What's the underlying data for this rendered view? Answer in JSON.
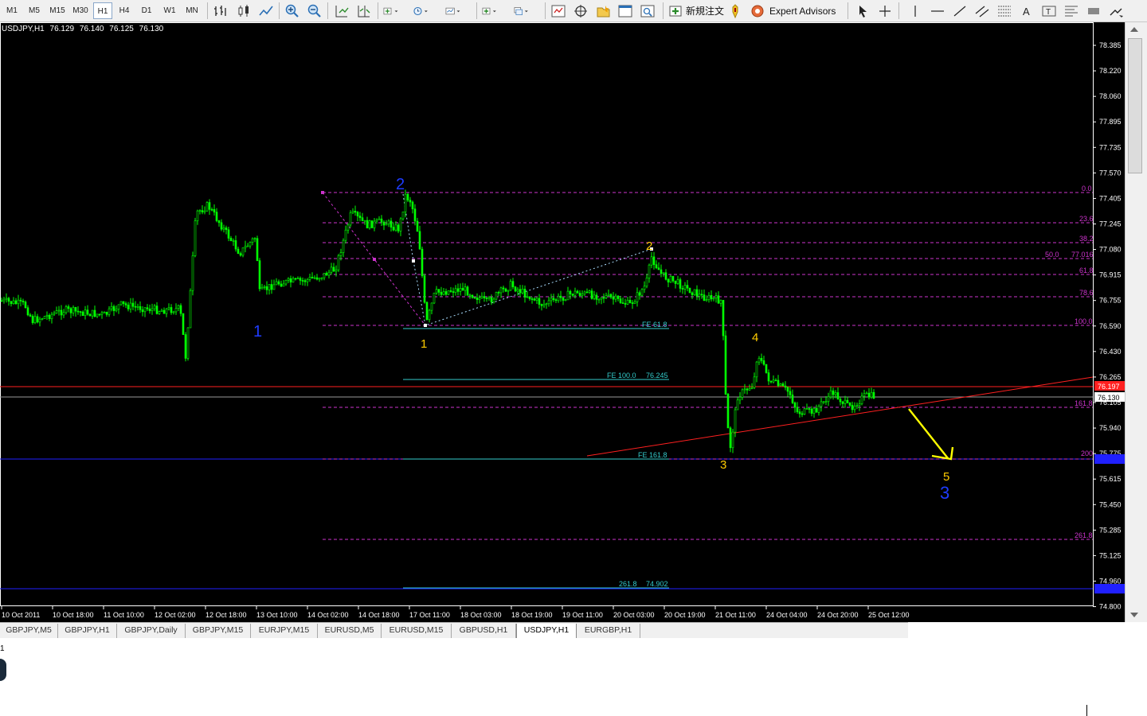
{
  "toolbar": {
    "timeframes": [
      {
        "label": "M1",
        "active": false
      },
      {
        "label": "M5",
        "active": false
      },
      {
        "label": "M15",
        "active": false
      },
      {
        "label": "M30",
        "active": false
      },
      {
        "label": "H1",
        "active": true
      },
      {
        "label": "H4",
        "active": false
      },
      {
        "label": "D1",
        "active": false
      },
      {
        "label": "W1",
        "active": false
      },
      {
        "label": "MN",
        "active": false
      }
    ],
    "new_order_label": "新規注文",
    "expert_advisors_label": "Expert Advisors",
    "icons": [
      "bar-chart-icon",
      "candlestick-icon",
      "line-chart-icon",
      "zoom-in-icon",
      "zoom-out-icon",
      "autoscroll-icon",
      "chart-shift-icon",
      "indicators-icon",
      "periods-icon",
      "templates-icon",
      "new-chart-icon",
      "profiles-icon",
      "market-watch-icon",
      "data-window-icon",
      "navigator-icon",
      "terminal-icon",
      "tester-icon",
      "new-order-icon",
      "expert-advisors-icon",
      "cursor-icon",
      "crosshair-icon",
      "vertical-line-icon",
      "horizontal-line-icon",
      "trendline-icon",
      "equidistant-channel-icon",
      "fibonacci-icon",
      "text-icon",
      "text-label-icon",
      "arrows-icon",
      "more-tools-icon"
    ]
  },
  "chart": {
    "symbol_label": "USDJPY,H1",
    "ohlc": [
      "76.129",
      "76.140",
      "76.125",
      "76.130"
    ],
    "background": "#000000",
    "candle_color": "#00ff00",
    "price_axis": [
      "78.385",
      "78.220",
      "78.060",
      "77.895",
      "77.735",
      "77.570",
      "77.405",
      "77.245",
      "77.080",
      "76.915",
      "76.755",
      "76.590",
      "76.430",
      "76.265",
      "76.105",
      "75.940",
      "75.775",
      "75.615",
      "75.450",
      "75.285",
      "75.125",
      "74.960",
      "74.800"
    ],
    "time_axis": [
      "10 Oct 2011",
      "10 Oct 18:00",
      "11 Oct 10:00",
      "12 Oct 02:00",
      "12 Oct 18:00",
      "13 Oct 10:00",
      "14 Oct 02:00",
      "14 Oct 18:00",
      "17 Oct 11:00",
      "18 Oct 03:00",
      "18 Oct 19:00",
      "19 Oct 11:00",
      "20 Oct 03:00",
      "20 Oct 19:00",
      "21 Oct 11:00",
      "24 Oct 04:00",
      "24 Oct 20:00",
      "25 Oct 12:00"
    ],
    "current_price_label": "76.130",
    "red_line_price_label": "76.197",
    "fib_levels": [
      "0.0",
      "23.6",
      "38.2",
      "50.0",
      "77.016",
      "61.8",
      "78.6",
      "100.0",
      "161.8",
      "200",
      "261.8"
    ],
    "fe_labels": [
      "FE 61.8",
      "FE 100.0",
      "76.245",
      "FE 161.8",
      "261.8",
      "74.902"
    ],
    "wave_labels": [
      "1",
      "2",
      "1",
      "2",
      "3",
      "4",
      "5",
      "3"
    ],
    "colors": {
      "fib": "#cc33cc",
      "fe": "#33cccc",
      "trendline": "#ff2020",
      "blue_line": "#2020ff",
      "arrow": "#ffff00",
      "wave_yellow": "#ffcc00",
      "wave_blue": "#1e3cff"
    }
  },
  "tabs": [
    {
      "label": "GBPJPY,M5",
      "active": false
    },
    {
      "label": "GBPJPY,H1",
      "active": false
    },
    {
      "label": "GBPJPY,Daily",
      "active": false
    },
    {
      "label": "GBPJPY,M15",
      "active": false
    },
    {
      "label": "EURJPY,M15",
      "active": false
    },
    {
      "label": "EURUSD,M5",
      "active": false
    },
    {
      "label": "EURUSD,M15",
      "active": false
    },
    {
      "label": "GBPUSD,H1",
      "active": false
    },
    {
      "label": "USDJPY,H1",
      "active": true
    },
    {
      "label": "EURGBP,H1",
      "active": false
    }
  ],
  "bottom": {
    "number": "1"
  }
}
